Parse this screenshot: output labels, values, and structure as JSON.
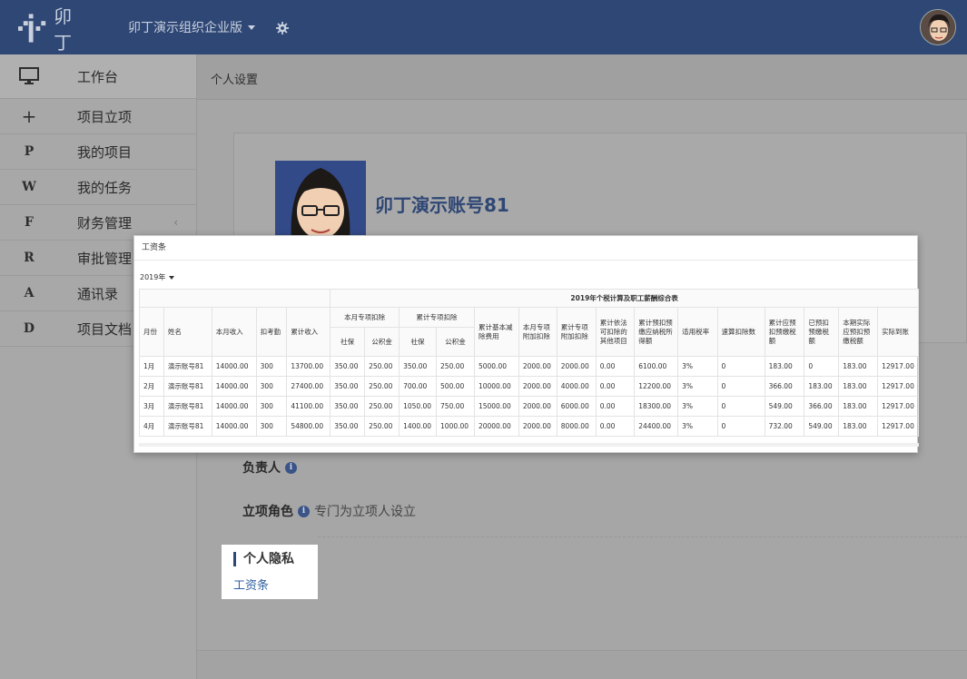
{
  "topbar": {
    "logo_text": "卯丁",
    "org_name": "卯丁演示组织企业版",
    "icons": {
      "settings": "gear-icon",
      "org_dropdown": "caret-down-icon"
    }
  },
  "sidebar": {
    "workbench": {
      "label": "工作台",
      "icon": "monitor-icon"
    },
    "items": [
      {
        "icon": "+",
        "label": "项目立项"
      },
      {
        "icon": "P",
        "label": "我的项目"
      },
      {
        "icon": "W",
        "label": "我的任务"
      },
      {
        "icon": "F",
        "label": "财务管理",
        "chevron": "‹"
      },
      {
        "icon": "R",
        "label": "审批管理"
      },
      {
        "icon": "A",
        "label": "通讯录"
      },
      {
        "icon": "D",
        "label": "项目文档"
      }
    ]
  },
  "breadcrumb": "个人设置",
  "profile": {
    "name": "卯丁演示账号81"
  },
  "fields": {
    "owner_label": "负责人",
    "role_label": "立项角色",
    "role_desc": "专门为立项人设立"
  },
  "privacy": {
    "title": "个人隐私",
    "link": "工资条"
  },
  "modal": {
    "title": "工资条",
    "year": "2019年",
    "table_title": "2019年个税计算及职工薪酬综合表",
    "headers": {
      "month": "月份",
      "name": "姓名",
      "income": "本月收入",
      "attendance": "扣考勤",
      "cum_income": "累计收入",
      "monthly_special": "本月专项扣除",
      "cum_special": "累计专项扣除",
      "social": "社保",
      "fund": "公积金",
      "cum_basic": "累计基本减除费用",
      "monthly_add": "本月专项附加扣除",
      "cum_add": "累计专项附加扣除",
      "cum_other": "累计依法可扣除的其他项目",
      "cum_taxable": "累计预扣预缴应纳税所得额",
      "rate": "适用税率",
      "quick": "速算扣除数",
      "cum_tax": "累计应预扣预缴税额",
      "paid_tax": "已预扣预缴税额",
      "month_tax": "本期实际应预扣预缴税额",
      "net": "实际到账"
    },
    "rows": [
      [
        "1月",
        "演示账号81",
        "14000.00",
        "300",
        "13700.00",
        "350.00",
        "250.00",
        "350.00",
        "250.00",
        "5000.00",
        "2000.00",
        "2000.00",
        "0.00",
        "6100.00",
        "3%",
        "0",
        "183.00",
        "0",
        "183.00",
        "12917.00"
      ],
      [
        "2月",
        "演示账号81",
        "14000.00",
        "300",
        "27400.00",
        "350.00",
        "250.00",
        "700.00",
        "500.00",
        "10000.00",
        "2000.00",
        "4000.00",
        "0.00",
        "12200.00",
        "3%",
        "0",
        "366.00",
        "183.00",
        "183.00",
        "12917.00"
      ],
      [
        "3月",
        "演示账号81",
        "14000.00",
        "300",
        "41100.00",
        "350.00",
        "250.00",
        "1050.00",
        "750.00",
        "15000.00",
        "2000.00",
        "6000.00",
        "0.00",
        "18300.00",
        "3%",
        "0",
        "549.00",
        "366.00",
        "183.00",
        "12917.00"
      ],
      [
        "4月",
        "演示账号81",
        "14000.00",
        "300",
        "54800.00",
        "350.00",
        "250.00",
        "1400.00",
        "1000.00",
        "20000.00",
        "2000.00",
        "8000.00",
        "0.00",
        "24400.00",
        "3%",
        "0",
        "732.00",
        "549.00",
        "183.00",
        "12917.00"
      ]
    ]
  }
}
